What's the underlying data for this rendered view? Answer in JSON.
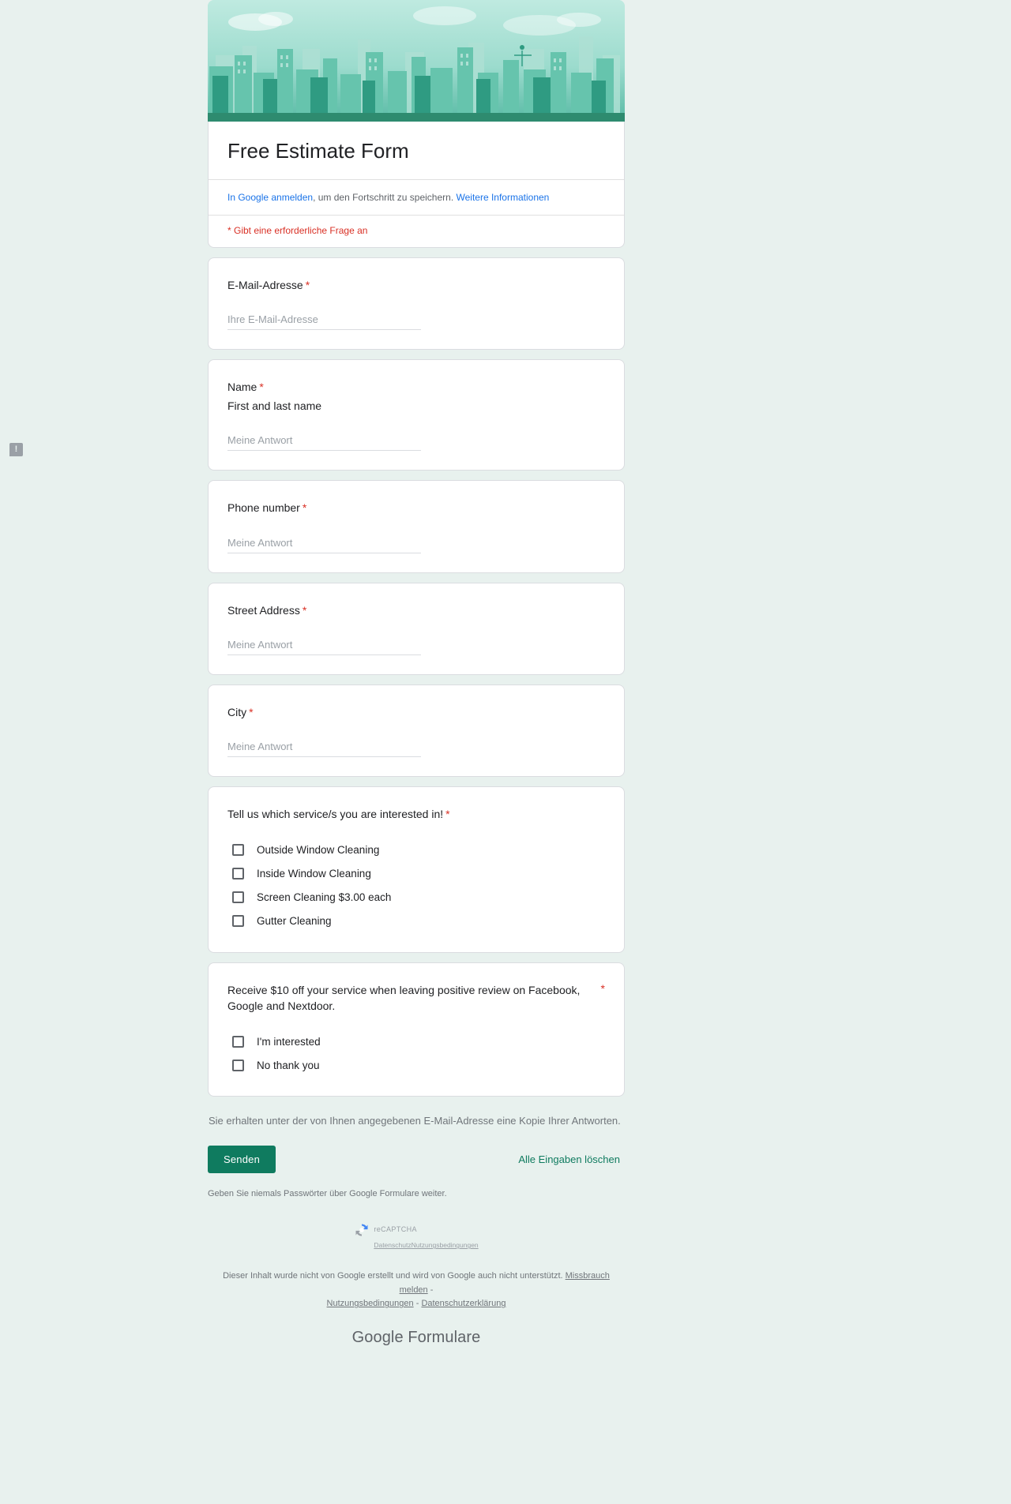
{
  "banner": {
    "alt": "city-skyline-illustration",
    "accent_color": "#2e8b6f"
  },
  "header": {
    "title": "Free Estimate Form",
    "signin_prefix": "In Google anmelden",
    "signin_middle": ", um den Fortschritt zu speichern.",
    "signin_more": "Weitere Informationen",
    "required_note": "* Gibt eine erforderliche Frage an"
  },
  "questions": [
    {
      "id": "email",
      "label": "E-Mail-Adresse",
      "required": true,
      "placeholder": "Ihre E-Mail-Adresse"
    },
    {
      "id": "name",
      "label": "Name",
      "required": true,
      "description": "First and last name",
      "placeholder": "Meine Antwort"
    },
    {
      "id": "phone",
      "label": "Phone number",
      "required": true,
      "placeholder": "Meine Antwort"
    },
    {
      "id": "street-address",
      "label": "Street Address",
      "required": true,
      "placeholder": "Meine Antwort"
    },
    {
      "id": "city",
      "label": "City",
      "required": true,
      "placeholder": "Meine Antwort"
    }
  ],
  "services_question": {
    "label": "Tell us which service/s you are interested in!",
    "required": true,
    "options": [
      "Outside Window Cleaning",
      "Inside Window Cleaning",
      "Screen Cleaning $3.00 each",
      "Gutter Cleaning"
    ]
  },
  "review_question": {
    "label": "Receive $10 off your service when leaving positive review on Facebook, Google and Nextdoor.",
    "required": true,
    "options": [
      "I'm interested",
      "No thank you"
    ]
  },
  "footer": {
    "copy_note": "Sie erhalten unter der von Ihnen angegebenen E-Mail-Adresse eine Kopie Ihrer Antworten.",
    "submit_label": "Senden",
    "clear_label": "Alle Eingaben löschen",
    "password_note": "Geben Sie niemals Passwörter über Google Formulare weiter.",
    "recaptcha_title": "reCAPTCHA",
    "recaptcha_privacy": "Datenschutz",
    "recaptcha_terms": "Nutzungsbedingungen",
    "disclaimer_text": "Dieser Inhalt wurde nicht von Google erstellt und wird von Google auch nicht unterstützt.",
    "disclaimer_report": "Missbrauch melden",
    "disclaimer_dash": "-",
    "disclaimer_terms": "Nutzungsbedingungen",
    "disclaimer_sep": "-",
    "disclaimer_privacy": "Datenschutzerklärung",
    "brand": "Google Formulare"
  },
  "icons": {
    "feedback": "!"
  }
}
